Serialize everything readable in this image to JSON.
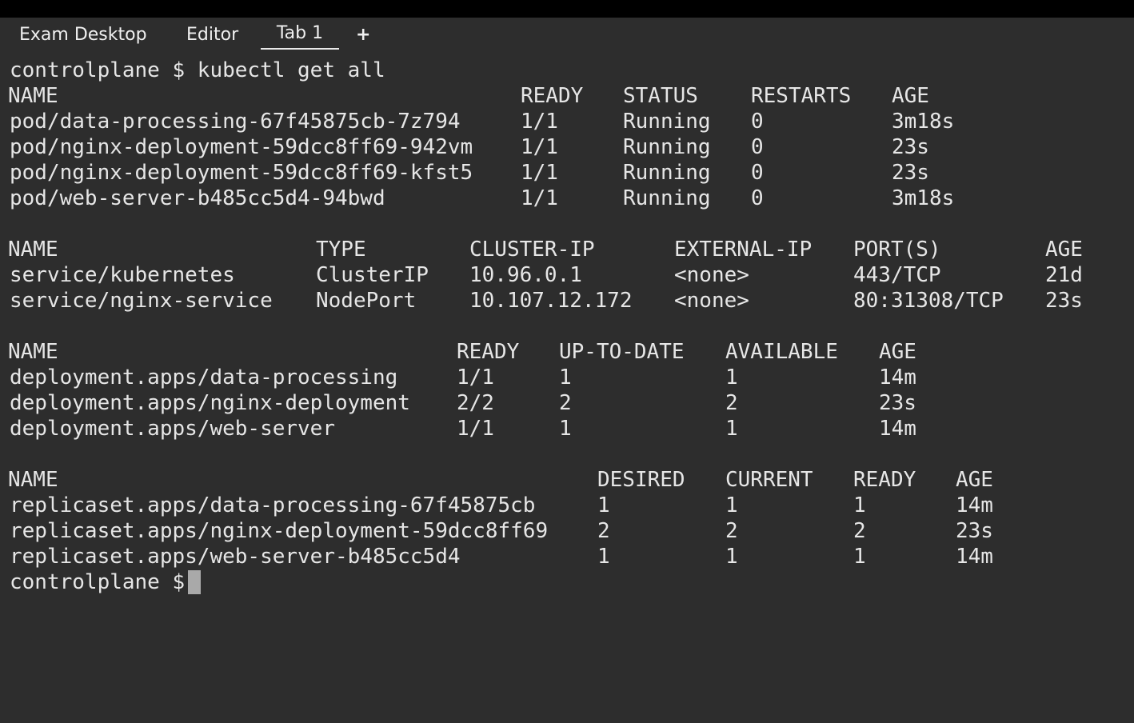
{
  "tabs": {
    "items": [
      "Exam Desktop",
      "Editor",
      "Tab 1"
    ],
    "add_label": "+"
  },
  "terminal": {
    "command_prompt": "controlplane $ kubectl get all",
    "pods": {
      "headers": [
        "NAME",
        "READY",
        "STATUS",
        "RESTARTS",
        "AGE"
      ],
      "rows": [
        [
          "pod/data-processing-67f45875cb-7z794",
          "1/1",
          "Running",
          "0",
          "3m18s"
        ],
        [
          "pod/nginx-deployment-59dcc8ff69-942vm",
          "1/1",
          "Running",
          "0",
          "23s"
        ],
        [
          "pod/nginx-deployment-59dcc8ff69-kfst5",
          "1/1",
          "Running",
          "0",
          "23s"
        ],
        [
          "pod/web-server-b485cc5d4-94bwd",
          "1/1",
          "Running",
          "0",
          "3m18s"
        ]
      ]
    },
    "services": {
      "headers": [
        "NAME",
        "TYPE",
        "CLUSTER-IP",
        "EXTERNAL-IP",
        "PORT(S)",
        "AGE"
      ],
      "rows": [
        [
          "service/kubernetes",
          "ClusterIP",
          "10.96.0.1",
          "<none>",
          "443/TCP",
          "21d"
        ],
        [
          "service/nginx-service",
          "NodePort",
          "10.107.12.172",
          "<none>",
          "80:31308/TCP",
          "23s"
        ]
      ]
    },
    "deployments": {
      "headers": [
        "NAME",
        "READY",
        "UP-TO-DATE",
        "AVAILABLE",
        "AGE"
      ],
      "rows": [
        [
          "deployment.apps/data-processing",
          "1/1",
          "1",
          "1",
          "14m"
        ],
        [
          "deployment.apps/nginx-deployment",
          "2/2",
          "2",
          "2",
          "23s"
        ],
        [
          "deployment.apps/web-server",
          "1/1",
          "1",
          "1",
          "14m"
        ]
      ]
    },
    "replicasets": {
      "headers": [
        "NAME",
        "DESIRED",
        "CURRENT",
        "READY",
        "AGE"
      ],
      "rows": [
        [
          "replicaset.apps/data-processing-67f45875cb",
          "1",
          "1",
          "1",
          "14m"
        ],
        [
          "replicaset.apps/nginx-deployment-59dcc8ff69",
          "2",
          "2",
          "2",
          "23s"
        ],
        [
          "replicaset.apps/web-server-b485cc5d4",
          "1",
          "1",
          "1",
          "14m"
        ]
      ]
    },
    "final_prompt": "controlplane $"
  }
}
